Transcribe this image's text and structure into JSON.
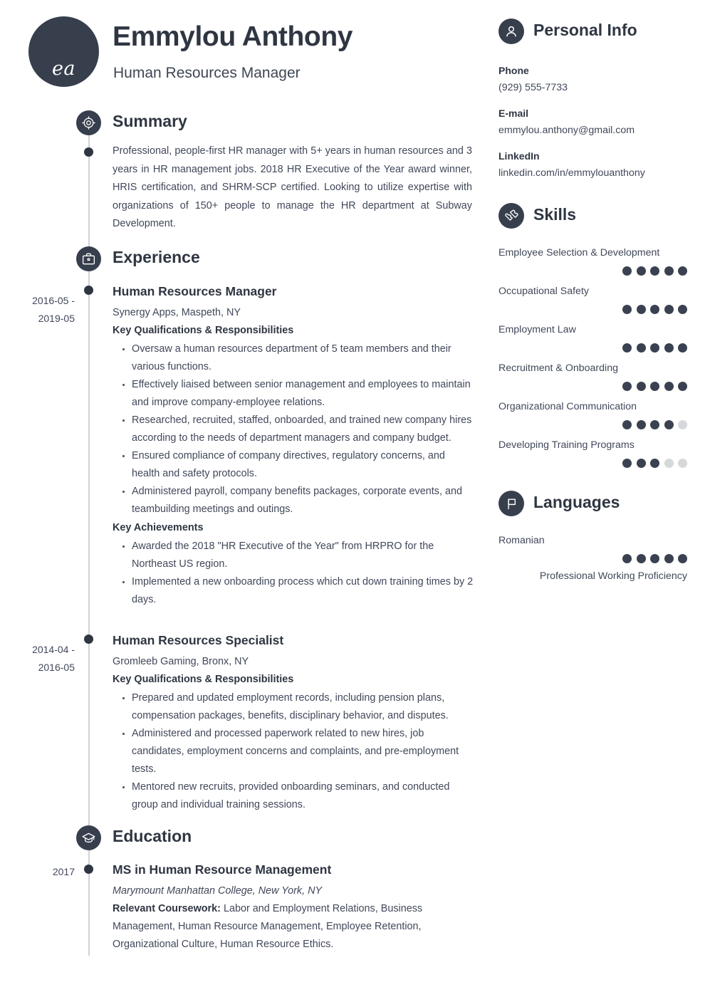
{
  "colors": {
    "accent_dark": "#373f4d",
    "text": "#41485a",
    "heading": "#2f3642",
    "spine": "#cfd2d6",
    "dot_off": "#d6d8da"
  },
  "header": {
    "initials": "ea",
    "name": "Emmylou Anthony",
    "job_title": "Human Resources Manager"
  },
  "summary": {
    "heading": "Summary",
    "icon": "target-icon",
    "text": "Professional, people-first HR manager with 5+ years in human resources and 3 years in HR management jobs. 2018 HR Executive of the Year award winner, HRIS certification, and SHRM-SCP certified. Looking to utilize expertise with organizations of 150+ people to manage the HR department at Subway Development."
  },
  "experience": {
    "heading": "Experience",
    "icon": "briefcase-icon",
    "entries": [
      {
        "dates": "2016-05 - 2019-05",
        "title": "Human Resources Manager",
        "company": "Synergy Apps, Maspeth, NY",
        "qualifications_label": "Key Qualifications & Responsibilities",
        "qualifications": [
          "Oversaw a human resources department of 5 team members and their various functions.",
          "Effectively liaised between senior management and employees to maintain and improve company-employee relations.",
          "Researched, recruited, staffed, onboarded, and trained new company hires according to the needs of department managers and company budget.",
          "Ensured compliance of company directives, regulatory concerns, and health and safety protocols.",
          "Administered payroll, company benefits packages, corporate events, and teambuilding meetings and outings."
        ],
        "achievements_label": "Key Achievements",
        "achievements": [
          "Awarded the 2018 \"HR Executive of the Year\" from HRPRO for the Northeast US region.",
          "Implemented a new onboarding process which cut down training times by 2 days."
        ]
      },
      {
        "dates": "2014-04 - 2016-05",
        "title": "Human Resources Specialist",
        "company": "Gromleeb Gaming, Bronx, NY",
        "qualifications_label": "Key Qualifications & Responsibilities",
        "qualifications": [
          "Prepared and updated employment records, including pension plans, compensation packages, benefits, disciplinary behavior, and disputes.",
          "Administered and processed paperwork related to new hires, job candidates, employment concerns and complaints, and pre-employment tests.",
          "Mentored new recruits, provided onboarding seminars, and conducted group and individual training sessions."
        ]
      }
    ]
  },
  "education": {
    "heading": "Education",
    "icon": "graduation-cap-icon",
    "entries": [
      {
        "dates": "2017",
        "degree": "MS in Human Resource Management",
        "school": "Marymount Manhattan College, New York, NY",
        "coursework_label": "Relevant Coursework:",
        "coursework": " Labor and Employment Relations, Business Management, Human Resource Management, Employee Retention, Organizational Culture, Human Resource Ethics."
      }
    ]
  },
  "personal_info": {
    "heading": "Personal Info",
    "icon": "person-icon",
    "items": [
      {
        "label": "Phone",
        "value": "(929) 555-7733"
      },
      {
        "label": "E-mail",
        "value": "emmylou.anthony@gmail.com"
      },
      {
        "label": "LinkedIn",
        "value": "linkedin.com/in/emmylouanthony"
      }
    ]
  },
  "skills": {
    "heading": "Skills",
    "icon": "puzzle-piece-icon",
    "max_rating": 5,
    "items": [
      {
        "name": "Employee Selection & Development",
        "rating": 5
      },
      {
        "name": "Occupational Safety",
        "rating": 5
      },
      {
        "name": "Employment Law",
        "rating": 5
      },
      {
        "name": "Recruitment & Onboarding",
        "rating": 5
      },
      {
        "name": "Organizational Communication",
        "rating": 4
      },
      {
        "name": "Developing Training Programs",
        "rating": 3
      }
    ]
  },
  "languages": {
    "heading": "Languages",
    "icon": "flag-icon",
    "max_rating": 5,
    "items": [
      {
        "name": "Romanian",
        "rating": 5,
        "level": "Professional Working Proficiency"
      }
    ]
  }
}
